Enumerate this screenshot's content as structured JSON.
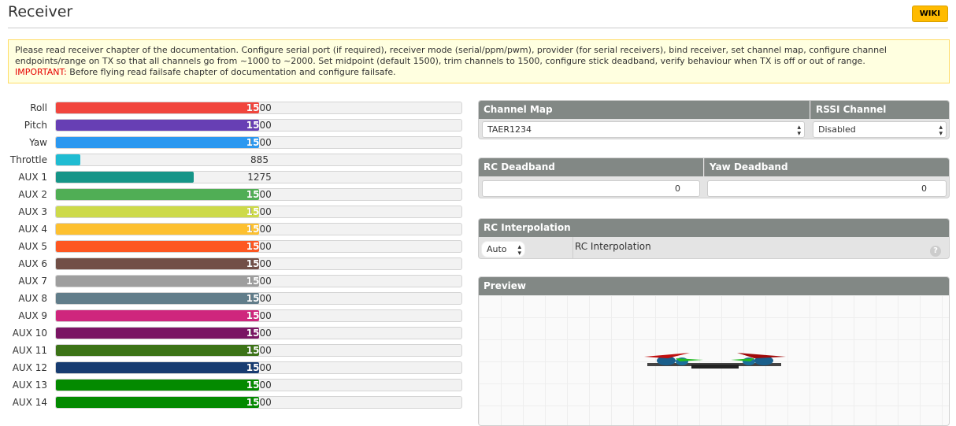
{
  "header": {
    "title": "Receiver",
    "wiki_label": "WIKI"
  },
  "note": {
    "text": "Please read receiver chapter of the documentation. Configure serial port (if required), receiver mode (serial/ppm/pwm), provider (for serial receivers), bind receiver, set channel map, configure channel endpoints/range on TX so that all channels go from ~1000 to ~2000. Set midpoint (default 1500), trim channels to 1500, configure stick deadband, verify behaviour when TX is off or out of range.",
    "important_label": "IMPORTANT:",
    "important_text": " Before flying read failsafe chapter of documentation and configure failsafe."
  },
  "channel_range": [
    800,
    2200
  ],
  "channels": [
    {
      "name": "Roll",
      "value": "1500",
      "color": "#f1453d"
    },
    {
      "name": "Pitch",
      "value": "1500",
      "color": "#673fb4"
    },
    {
      "name": "Yaw",
      "value": "1500",
      "color": "#2b98f0"
    },
    {
      "name": "Throttle",
      "value": "885",
      "color": "#1fbcd2"
    },
    {
      "name": "AUX 1",
      "value": "1275",
      "color": "#159588"
    },
    {
      "name": "AUX 2",
      "value": "1500",
      "color": "#50ae55"
    },
    {
      "name": "AUX 3",
      "value": "1500",
      "color": "#cdda49"
    },
    {
      "name": "AUX 4",
      "value": "1500",
      "color": "#fdc02f"
    },
    {
      "name": "AUX 5",
      "value": "1500",
      "color": "#fd5722"
    },
    {
      "name": "AUX 6",
      "value": "1500",
      "color": "#724f47"
    },
    {
      "name": "AUX 7",
      "value": "1500",
      "color": "#9e9e9e"
    },
    {
      "name": "AUX 8",
      "value": "1500",
      "color": "#617d8a"
    },
    {
      "name": "AUX 9",
      "value": "1500",
      "color": "#cf267d"
    },
    {
      "name": "AUX 10",
      "value": "1500",
      "color": "#7a1463"
    },
    {
      "name": "AUX 11",
      "value": "1500",
      "color": "#3c7317"
    },
    {
      "name": "AUX 12",
      "value": "1500",
      "color": "#173c71"
    },
    {
      "name": "AUX 13",
      "value": "1500",
      "color": "#048a00"
    },
    {
      "name": "AUX 14",
      "value": "1500",
      "color": "#038a00"
    }
  ],
  "channel_map": {
    "label": "Channel Map",
    "value": "TAER1234"
  },
  "rssi": {
    "label": "RSSI Channel",
    "value": "Disabled"
  },
  "deadband": {
    "rc_label": "RC Deadband",
    "rc_value": "0",
    "yaw_label": "Yaw Deadband",
    "yaw_value": "0"
  },
  "interpolation": {
    "label": "RC Interpolation",
    "value": "Auto",
    "description": "RC Interpolation",
    "help": "?"
  },
  "preview": {
    "label": "Preview"
  }
}
